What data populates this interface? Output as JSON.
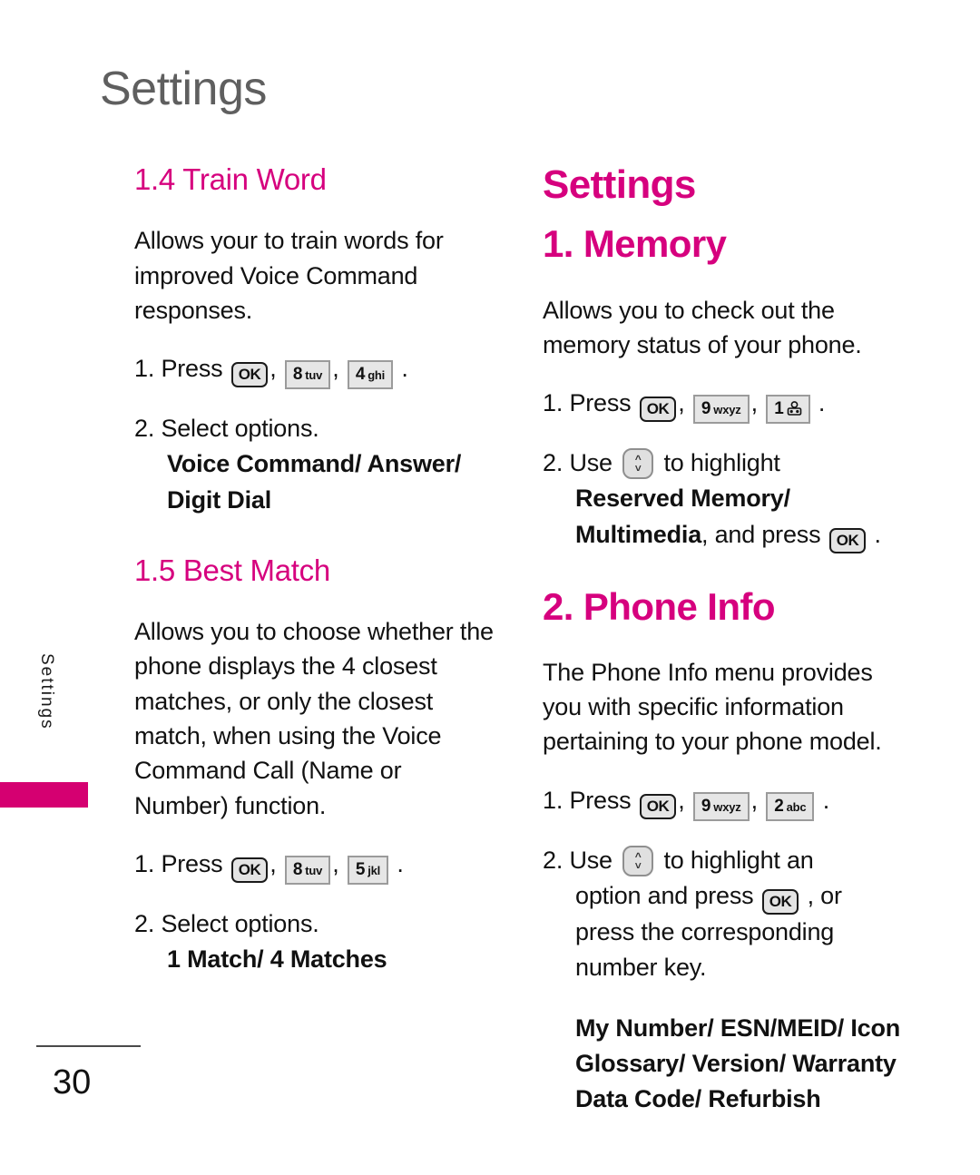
{
  "page": {
    "header_title": "Settings",
    "page_number": "30",
    "side_tab_label": "Settings",
    "accent_color": "#D6007E",
    "tab_block_color": "#D50071",
    "header_color": "#5F5F5F"
  },
  "left_column": {
    "sections": [
      {
        "heading": "1.4 Train Word",
        "body": "Allows your to train words for improved Voice Command responses.",
        "steps": [
          {
            "number": "1.",
            "text_before": "Press",
            "keys": [
              "OK",
              "8 tuv",
              "4 ghi"
            ],
            "text_after": "."
          },
          {
            "number": "2.",
            "text_before": "Select options.",
            "options": "Voice Command/ Answer/ Digit Dial"
          }
        ]
      },
      {
        "heading": "1.5 Best Match",
        "body": "Allows you to choose whether the phone displays the 4 closest matches, or only the closest match, when using the Voice Command Call (Name or Number) function.",
        "steps": [
          {
            "number": "1.",
            "text_before": "Press",
            "keys": [
              "OK",
              "8 tuv",
              "5 jkl"
            ],
            "text_after": "."
          },
          {
            "number": "2.",
            "text_before": "Select options.",
            "options": "1 Match/ 4 Matches"
          }
        ]
      }
    ]
  },
  "right_column": {
    "section_title": "Settings",
    "sections": [
      {
        "heading": "1. Memory",
        "body": "Allows you to check out the memory status of your phone.",
        "step1": {
          "number": "1.",
          "label": "Press",
          "key_ok": "OK",
          "key_9_digit": "9",
          "key_9_letters": "wxyz",
          "key_1_digit": "1",
          "key_1_icon": "voicemail-icon",
          "comma": ",",
          "period": "."
        },
        "step2": {
          "number": "2.",
          "label_before": "Use",
          "nav_icon": "up-down-arrows-icon",
          "label_after": "to highlight",
          "bold_options_line1": "Reserved Memory/",
          "bold_options_line2": "Multimedia",
          "tail_text": ", and press",
          "key_ok": "OK",
          "period": "."
        }
      },
      {
        "heading": "2. Phone Info",
        "body": "The Phone Info menu provides you with specific information pertaining to your phone model.",
        "step1": {
          "number": "1.",
          "label": "Press",
          "key_ok": "OK",
          "key_9_digit": "9",
          "key_9_letters": "wxyz",
          "key_2_digit": "2",
          "key_2_letters": "abc",
          "comma": ",",
          "period": "."
        },
        "step2": {
          "number": "2.",
          "label_before": "Use",
          "nav_icon": "up-down-arrows-icon",
          "label_after": "to highlight an",
          "line2_before": "option and press",
          "key_ok": "OK",
          "line2_after": ", or",
          "line3": "press the corresponding",
          "line4": "number key."
        },
        "menu_options": [
          "My Number/ ESN/MEID/ Icon",
          "Glossary/ Version/ Warranty",
          "Data Code/ Refurbish"
        ]
      }
    ]
  },
  "keys": {
    "ok_label": "OK",
    "comma": ",",
    "period": "."
  }
}
